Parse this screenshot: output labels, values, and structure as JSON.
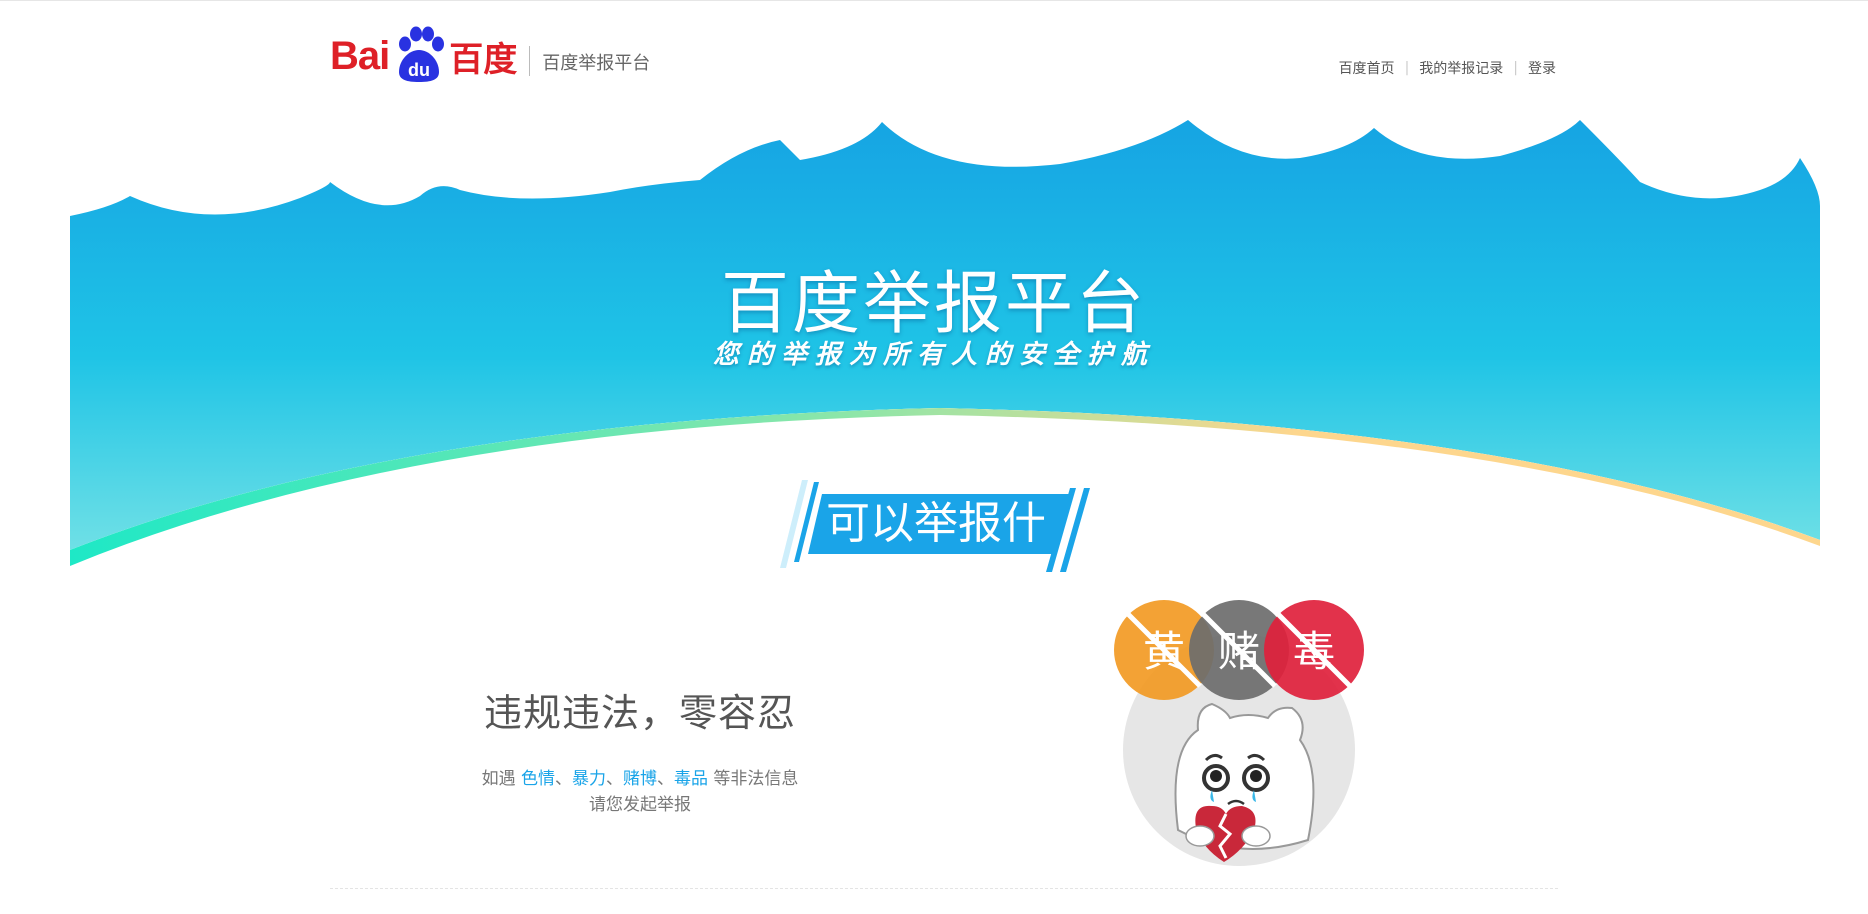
{
  "header": {
    "logo_text_latin": "Bai",
    "logo_text_du": "du",
    "logo_text_cn": "百度",
    "platform_name": "百度举报平台"
  },
  "nav": {
    "items": [
      {
        "label": "百度首页"
      },
      {
        "label": "我的举报记录"
      },
      {
        "label": "登录"
      }
    ],
    "separator": "|"
  },
  "banner": {
    "title": "百度举报平台",
    "slogan": "您的举报为所有人的安全护航"
  },
  "section": {
    "heading": "可以举报什么?"
  },
  "lead": {
    "title": "违规违法，零容忍",
    "desc_prefix": "如遇 ",
    "categories": [
      "色情",
      "暴力",
      "赌博",
      "毒品"
    ],
    "sep": "、",
    "desc_suffix": " 等非法信息",
    "desc_line2": "请您发起举报"
  },
  "illustration": {
    "badges": [
      "黄",
      "赌",
      "毒"
    ],
    "badge_colors": [
      "#f29a24",
      "#6d6d6d",
      "#e0213c"
    ]
  },
  "colors": {
    "brand_red": "#de2027",
    "brand_blue": "#2932e1",
    "sky_top": "#16a4e3",
    "sky_bottom": "#3fd6e8",
    "accent_green": "#1ee8c6",
    "accent_orange": "#fdd68d",
    "link_blue": "#1aa4e8"
  }
}
